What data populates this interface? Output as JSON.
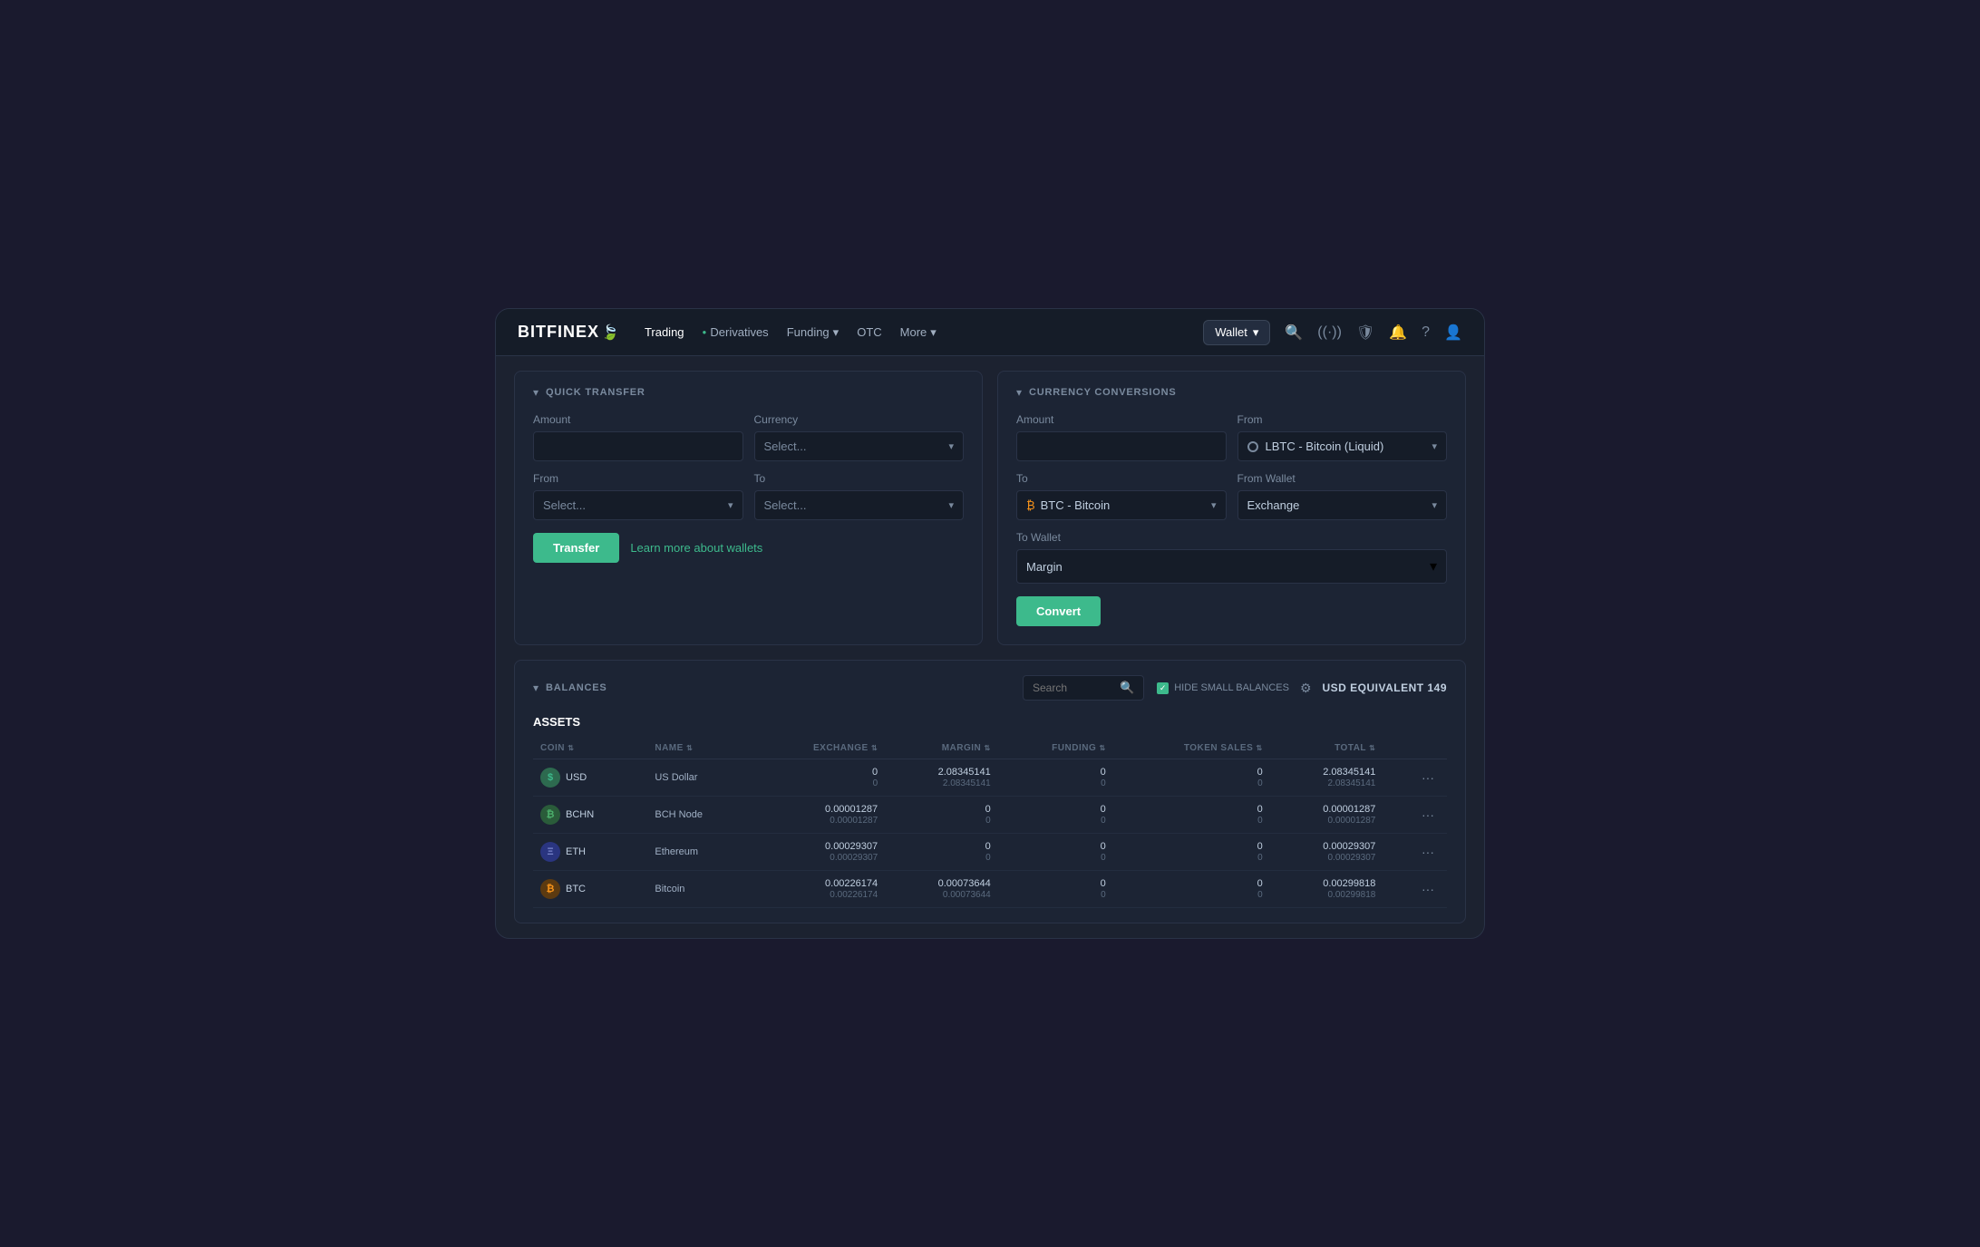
{
  "brand": {
    "name": "BITFINEX",
    "leaf": "🍃"
  },
  "navbar": {
    "items": [
      {
        "label": "Trading",
        "active": false
      },
      {
        "label": "Derivatives",
        "active": false,
        "dot": true
      },
      {
        "label": "Funding",
        "active": false,
        "dropdown": true
      },
      {
        "label": "OTC",
        "active": false
      },
      {
        "label": "More",
        "active": false,
        "dropdown": true
      }
    ],
    "wallet_btn": "Wallet",
    "icons": [
      "search",
      "signal",
      "shield",
      "bell",
      "help",
      "user"
    ]
  },
  "quick_transfer": {
    "title": "QUICK TRANSFER",
    "amount_label": "Amount",
    "amount_placeholder": "",
    "currency_label": "Currency",
    "currency_placeholder": "Select...",
    "from_label": "From",
    "from_placeholder": "Select...",
    "to_label": "To",
    "to_placeholder": "Select...",
    "transfer_btn": "Transfer",
    "learn_more_link": "Learn more about wallets"
  },
  "currency_conversions": {
    "title": "CURRENCY CONVERSIONS",
    "amount_label": "Amount",
    "amount_placeholder": "",
    "from_label": "From",
    "from_value": "LBTC - Bitcoin (Liquid)",
    "to_label": "To",
    "to_value": "BTC - Bitcoin",
    "from_wallet_label": "From Wallet",
    "from_wallet_value": "Exchange",
    "to_wallet_label": "To Wallet",
    "to_wallet_value": "Margin",
    "convert_btn": "Convert"
  },
  "balances": {
    "title": "BALANCES",
    "search_placeholder": "Search",
    "hide_small_label": "HIDE SMALL BALANCES",
    "usd_equiv_label": "USD EQUIVALENT",
    "usd_equiv_value": "149",
    "assets_label": "ASSETS",
    "table": {
      "headers": [
        "COIN",
        "NAME",
        "EXCHANGE",
        "MARGIN",
        "FUNDING",
        "TOKEN SALES",
        "TOTAL",
        ""
      ],
      "rows": [
        {
          "coin": "USD",
          "coin_type": "usd",
          "name": "US Dollar",
          "exchange": [
            "0",
            "0"
          ],
          "margin": [
            "2.08345141",
            "2.08345141"
          ],
          "funding": [
            "0",
            "0"
          ],
          "token_sales": [
            "0",
            "0"
          ],
          "total": [
            "2.08345141",
            "2.08345141"
          ]
        },
        {
          "coin": "BCHN",
          "coin_type": "bchn",
          "name": "BCH Node",
          "exchange": [
            "0.00001287",
            "0.00001287"
          ],
          "margin": [
            "0",
            "0"
          ],
          "funding": [
            "0",
            "0"
          ],
          "token_sales": [
            "0",
            "0"
          ],
          "total": [
            "0.00001287",
            "0.00001287"
          ]
        },
        {
          "coin": "ETH",
          "coin_type": "eth",
          "name": "Ethereum",
          "exchange": [
            "0.00029307",
            "0.00029307"
          ],
          "margin": [
            "0",
            "0"
          ],
          "funding": [
            "0",
            "0"
          ],
          "token_sales": [
            "0",
            "0"
          ],
          "total": [
            "0.00029307",
            "0.00029307"
          ]
        },
        {
          "coin": "BTC",
          "coin_type": "btc",
          "name": "Bitcoin",
          "exchange": [
            "0.00226174",
            "0.00226174"
          ],
          "margin": [
            "0.00073644",
            "0.00073644"
          ],
          "funding": [
            "0",
            "0"
          ],
          "token_sales": [
            "0",
            "0"
          ],
          "total": [
            "0.00299818",
            "0.00299818"
          ]
        }
      ]
    }
  }
}
